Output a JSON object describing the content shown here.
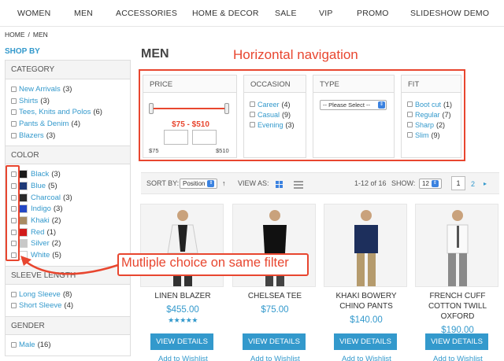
{
  "topnav": {
    "items": [
      "WOMEN",
      "MEN",
      "ACCESSORIES",
      "HOME & DECOR",
      "SALE",
      "VIP",
      "PROMO",
      "SLIDESHOW DEMO"
    ]
  },
  "breadcrumb": {
    "home": "HOME",
    "separator": "/",
    "current": "MEN"
  },
  "sidebar": {
    "heading": "SHOP BY",
    "category": {
      "title": "CATEGORY",
      "items": [
        {
          "label": "New Arrivals",
          "count": "(3)"
        },
        {
          "label": "Shirts",
          "count": "(3)"
        },
        {
          "label": "Tees, Knits and Polos",
          "count": "(6)"
        },
        {
          "label": "Pants & Denim",
          "count": "(4)"
        },
        {
          "label": "Blazers",
          "count": "(3)"
        }
      ]
    },
    "color": {
      "title": "COLOR",
      "items": [
        {
          "label": "Black",
          "count": "(3)",
          "swatch": "#1a1a1a"
        },
        {
          "label": "Blue",
          "count": "(5)",
          "swatch": "#1f3a78"
        },
        {
          "label": "Charcoal",
          "count": "(3)",
          "swatch": "#2b2b2b"
        },
        {
          "label": "Indigo",
          "count": "(3)",
          "swatch": "#2447c4"
        },
        {
          "label": "Khaki",
          "count": "(2)",
          "swatch": "#a88b63"
        },
        {
          "label": "Red",
          "count": "(1)",
          "swatch": "#d11a1a"
        },
        {
          "label": "Silver",
          "count": "(2)",
          "swatch": "#c8c8c8"
        },
        {
          "label": "White",
          "count": "(5)",
          "swatch": "#ffffff"
        }
      ]
    },
    "sleeve": {
      "title": "SLEEVE LENGTH",
      "items": [
        {
          "label": "Long Sleeve",
          "count": "(8)"
        },
        {
          "label": "Short Sleeve",
          "count": "(4)"
        }
      ]
    },
    "gender": {
      "title": "GENDER",
      "items": [
        {
          "label": "Male",
          "count": "(16)"
        }
      ]
    }
  },
  "main": {
    "title": "MEN",
    "annotation_top": "Horizontal navigation",
    "annotation_callout": "Mutliple choice on same filter"
  },
  "filters": {
    "price": {
      "title": "PRICE",
      "range": "$75 - $510",
      "min": "$75",
      "max": "$510"
    },
    "occasion": {
      "title": "OCCASION",
      "items": [
        {
          "label": "Career",
          "count": "(4)"
        },
        {
          "label": "Casual",
          "count": "(9)"
        },
        {
          "label": "Evening",
          "count": "(3)"
        }
      ]
    },
    "type": {
      "title": "TYPE",
      "select": "-- Please Select --"
    },
    "fit": {
      "title": "FIT",
      "items": [
        {
          "label": "Boot cut",
          "count": "(1)"
        },
        {
          "label": "Regular",
          "count": "(7)"
        },
        {
          "label": "Sharp",
          "count": "(2)"
        },
        {
          "label": "Slim",
          "count": "(9)"
        }
      ]
    }
  },
  "toolbar": {
    "sort_label": "SORT BY:",
    "sort_value": "Position",
    "sort_dir": "↑",
    "view_label": "VIEW AS:",
    "count_text": "1-12 of 16",
    "show_label": "SHOW:",
    "show_value": "12",
    "page_current": "1",
    "page_next_num": "2",
    "page_next_arrow": "▸"
  },
  "products": [
    {
      "name": "LINEN BLAZER",
      "price": "$455.00",
      "stars": "★★★★★",
      "button": "VIEW DETAILS",
      "wishlist": "Add to Wishlist"
    },
    {
      "name": "CHELSEA TEE",
      "price": "$75.00",
      "stars": "",
      "button": "VIEW DETAILS",
      "wishlist": "Add to Wishlist"
    },
    {
      "name": "KHAKI BOWERY CHINO PANTS",
      "price": "$140.00",
      "stars": "",
      "button": "VIEW DETAILS",
      "wishlist": "Add to Wishlist"
    },
    {
      "name": "FRENCH CUFF COTTON TWILL OXFORD",
      "price": "$190.00",
      "stars": "",
      "button": "VIEW DETAILS",
      "wishlist": "Add to Wishlist"
    }
  ],
  "colors": {
    "accent": "#3399cc",
    "annotation": "#e8462f"
  }
}
